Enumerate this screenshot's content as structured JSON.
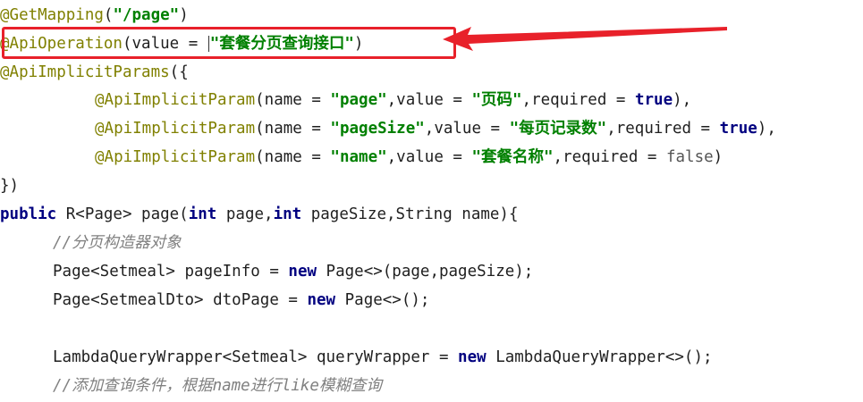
{
  "lines": {
    "l1": {
      "annotation": "@GetMapping",
      "rest": "(",
      "string": "\"/page\"",
      "close": ")"
    },
    "l2": {
      "annotation": "@ApiOperation",
      "rest": "(value = ",
      "string": "\"套餐分页查询接口\"",
      "close": ")"
    },
    "l3": {
      "annotation": "@ApiImplicitParams",
      "rest": "({"
    },
    "l4": {
      "annotation": "@ApiImplicitParam",
      "p1": "(name = ",
      "s1": "\"page\"",
      "p2": ",value = ",
      "s2": "\"页码\"",
      "p3": ",required = ",
      "kw": "true",
      "close": "),"
    },
    "l5": {
      "annotation": "@ApiImplicitParam",
      "p1": "(name = ",
      "s1": "\"pageSize\"",
      "p2": ",value = ",
      "s2": "\"每页记录数\"",
      "p3": ",required = ",
      "kw": "true",
      "close": "),"
    },
    "l6": {
      "annotation": "@ApiImplicitParam",
      "p1": "(name = ",
      "s1": "\"name\"",
      "p2": ",value = ",
      "s2": "\"套餐名称\"",
      "p3": ",required = ",
      "kw": "false",
      "close": ")"
    },
    "l7": {
      "text": "})"
    },
    "l8": {
      "kw1": "public",
      "t1": " R<Page> page(",
      "kw2": "int",
      "t2": " page,",
      "kw3": "int",
      "t3": " pageSize,String name){"
    },
    "l9": {
      "comment": "//分页构造器对象"
    },
    "l10": {
      "t1": "Page<Setmeal> pageInfo = ",
      "kw": "new",
      "t2": " Page<>(page,pageSize);"
    },
    "l11": {
      "t1": "Page<SetmealDto> dtoPage = ",
      "kw": "new",
      "t2": " Page<>();"
    },
    "l13": {
      "t1": "LambdaQueryWrapper<Setmeal> queryWrapper = ",
      "kw": "new",
      "t2": " LambdaQueryWrapper<>();"
    },
    "l14": {
      "comment": "//添加查询条件，根据name进行like模糊查询"
    }
  },
  "colors": {
    "annotation": "#808000",
    "keyword": "#000080",
    "string": "#008000",
    "comment": "#808080",
    "highlight": "#e8212a"
  }
}
